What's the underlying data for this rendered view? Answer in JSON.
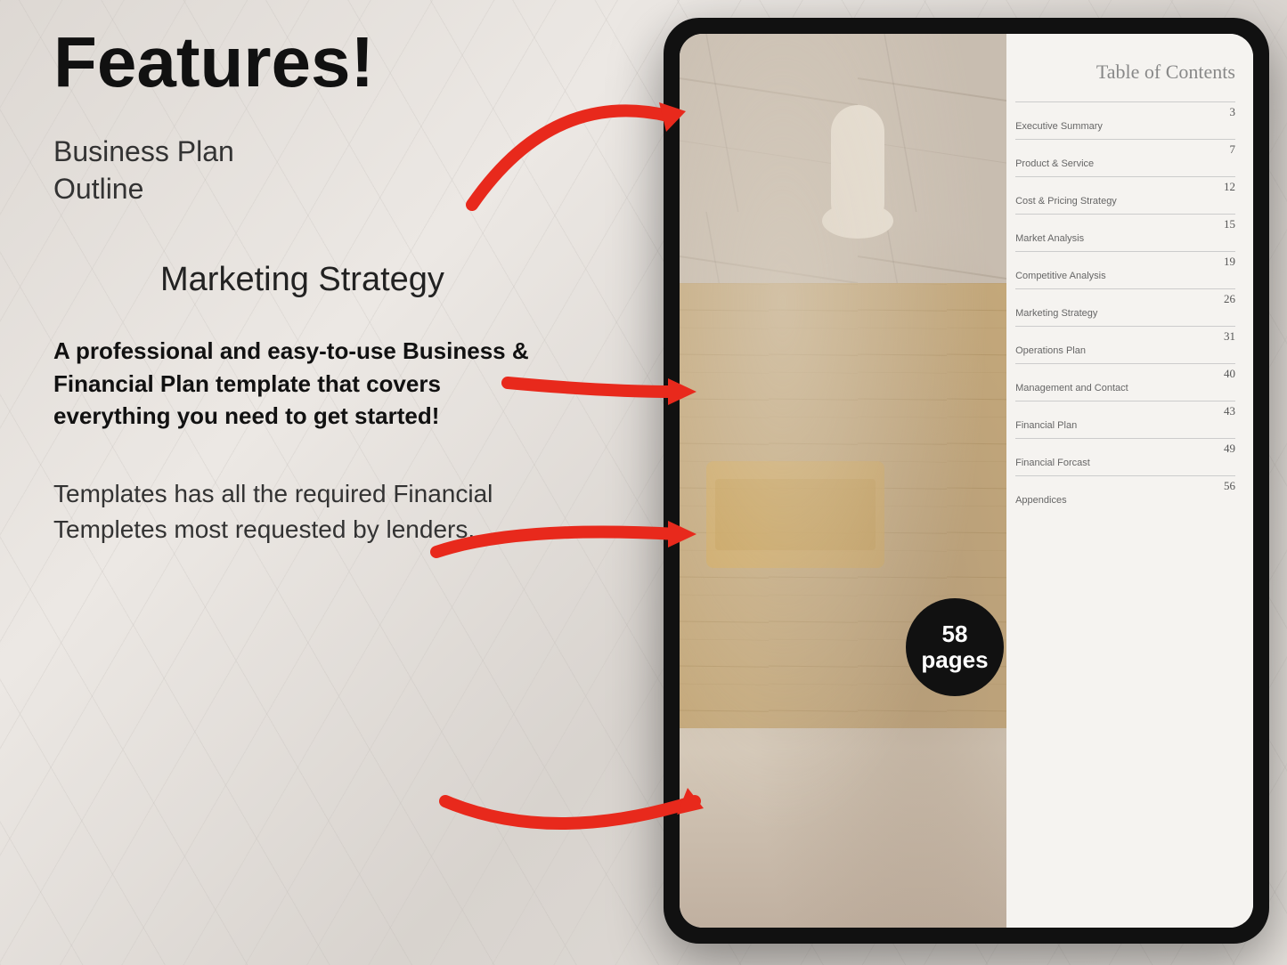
{
  "page": {
    "title": "Features!",
    "subtitle": "Business Plan\nOutline",
    "marketing_label": "Marketing Strategy",
    "description": "A professional and easy-to-use Business & Financial Plan template that covers everything you need to get started!",
    "templates_note": "Templates has all the required Financial Templetes most requested by lenders.",
    "badge": {
      "line1": "58",
      "line2": "pages"
    }
  },
  "toc": {
    "title": "Table of Contents",
    "items": [
      {
        "number": "3",
        "label": "Executive Summary"
      },
      {
        "number": "7",
        "label": "Product & Service"
      },
      {
        "number": "12",
        "label": "Cost & Pricing Strategy"
      },
      {
        "number": "15",
        "label": "Market Analysis"
      },
      {
        "number": "19",
        "label": "Competitive Analysis"
      },
      {
        "number": "26",
        "label": "Marketing Strategy"
      },
      {
        "number": "31",
        "label": "Operations Plan"
      },
      {
        "number": "40",
        "label": "Management and Contact"
      },
      {
        "number": "43",
        "label": "Financial Plan"
      },
      {
        "number": "49",
        "label": "Financial Forcast"
      },
      {
        "number": "56",
        "label": "Appendices"
      }
    ]
  }
}
